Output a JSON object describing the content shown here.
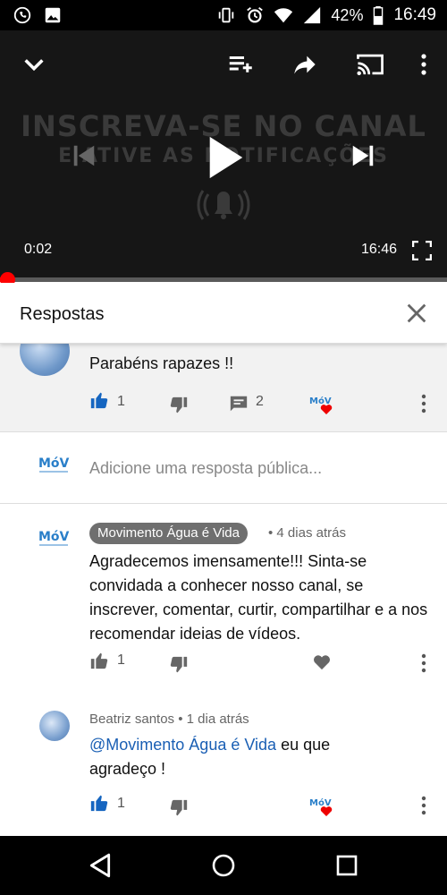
{
  "status_bar": {
    "battery": "42%",
    "time": "16:49",
    "icons": [
      "whatsapp-icon",
      "gallery-icon",
      "vibrate-icon",
      "alarm-icon",
      "wifi-icon",
      "signal-icon",
      "battery-icon"
    ]
  },
  "player": {
    "overlay_line1": "INSCREVA-SE NO CANAL",
    "overlay_line2": "E ATIVE AS NOTIFICAÇÕES",
    "current_time": "0:02",
    "duration": "16:46",
    "progress_fraction": 0.002,
    "accent_color": "#ff0000"
  },
  "sheet": {
    "title": "Respostas"
  },
  "parent_comment": {
    "text": "Parabéns  rapazes !!",
    "likes": "1",
    "replies": "2"
  },
  "add_reply": {
    "placeholder": "Adicione uma resposta pública..."
  },
  "replies": [
    {
      "author": "Movimento Água é Vida",
      "time": "• 4 dias atrás",
      "text": "Agradecemos imensamente!!! Sinta-se convidada a conhecer nosso canal, se inscrever, comentar, curtir, compartilhar e a nos recomendar ideias de vídeos.",
      "likes": "1"
    },
    {
      "author": "Beatriz santos",
      "time": "• 1 dia atrás",
      "mention": "@Movimento Água é Vida",
      "text": " eu que agradeço  !",
      "likes": "1"
    }
  ],
  "channel_logo_text": "MóV"
}
